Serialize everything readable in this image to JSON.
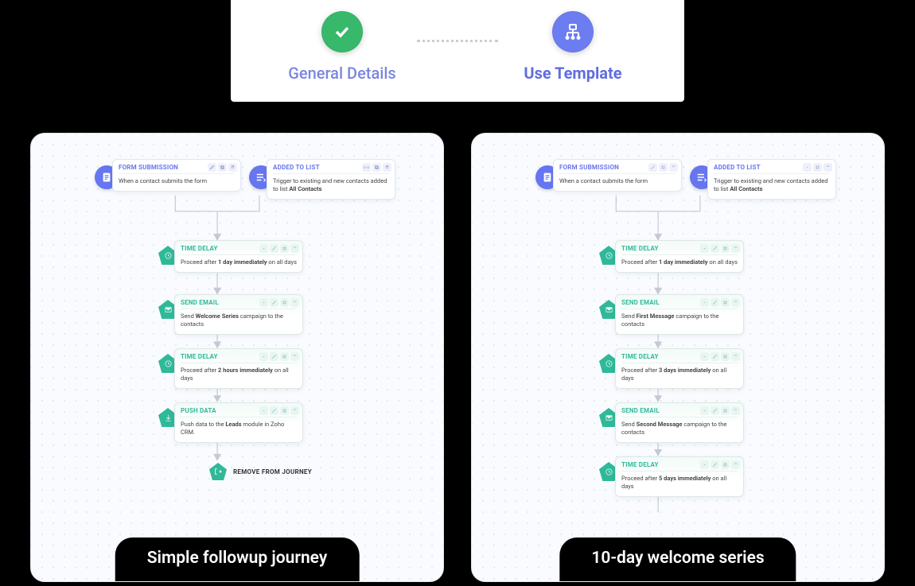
{
  "stepper": {
    "steps": [
      {
        "label": "General Details",
        "state": "done"
      },
      {
        "label": "Use Template",
        "state": "active"
      }
    ]
  },
  "templates": [
    {
      "id": "simple-followup",
      "caption": "Simple followup  journey",
      "triggers": [
        {
          "title": "FORM SUBMISSION",
          "desc_a": "When a contact submits the form",
          "desc_b": ""
        },
        {
          "title": "ADDED TO LIST",
          "desc_a": "Trigger to existing and new contacts added to list ",
          "desc_b": "All Contacts"
        }
      ],
      "actions": [
        {
          "kind": "delay",
          "title": "TIME DELAY",
          "desc_a": "Proceed after ",
          "desc_b": "1 day immediately",
          "desc_c": " on all days"
        },
        {
          "kind": "email",
          "title": "SEND EMAIL",
          "desc_a": "Send ",
          "desc_b": "Welcome Series",
          "desc_c": " campaign to the contacts"
        },
        {
          "kind": "delay",
          "title": "TIME DELAY",
          "desc_a": "Proceed after ",
          "desc_b": "2 hours immediately",
          "desc_c": " on all days"
        },
        {
          "kind": "push",
          "title": "PUSH DATA",
          "desc_a": "Push data to the ",
          "desc_b": "Leads",
          "desc_c": " module in Zoho CRM."
        }
      ],
      "end_label": "REMOVE FROM JOURNEY"
    },
    {
      "id": "10-day-welcome",
      "caption": "10-day welcome series",
      "triggers": [
        {
          "title": "FORM SUBMISSION",
          "desc_a": "When a contact submits the form",
          "desc_b": ""
        },
        {
          "title": "ADDED TO LIST",
          "desc_a": "Trigger to existing and new contacts added to list ",
          "desc_b": "All Contacts"
        }
      ],
      "actions": [
        {
          "kind": "delay",
          "title": "TIME DELAY",
          "desc_a": "Proceed after ",
          "desc_b": "1 day immediately",
          "desc_c": " on all days"
        },
        {
          "kind": "email",
          "title": "SEND EMAIL",
          "desc_a": "Send ",
          "desc_b": "First Message",
          "desc_c": " campaign to the contacts"
        },
        {
          "kind": "delay",
          "title": "TIME DELAY",
          "desc_a": "Proceed after ",
          "desc_b": "3 days immediately",
          "desc_c": " on all days"
        },
        {
          "kind": "email",
          "title": "SEND EMAIL",
          "desc_a": "Send ",
          "desc_b": "Second Message",
          "desc_c": " campaign to the contacts"
        },
        {
          "kind": "delay",
          "title": "TIME DELAY",
          "desc_a": "Proceed after ",
          "desc_b": "5 days immediately",
          "desc_c": " on all days"
        }
      ]
    }
  ],
  "tool_icons": [
    "link",
    "edit",
    "copy",
    "delete"
  ]
}
